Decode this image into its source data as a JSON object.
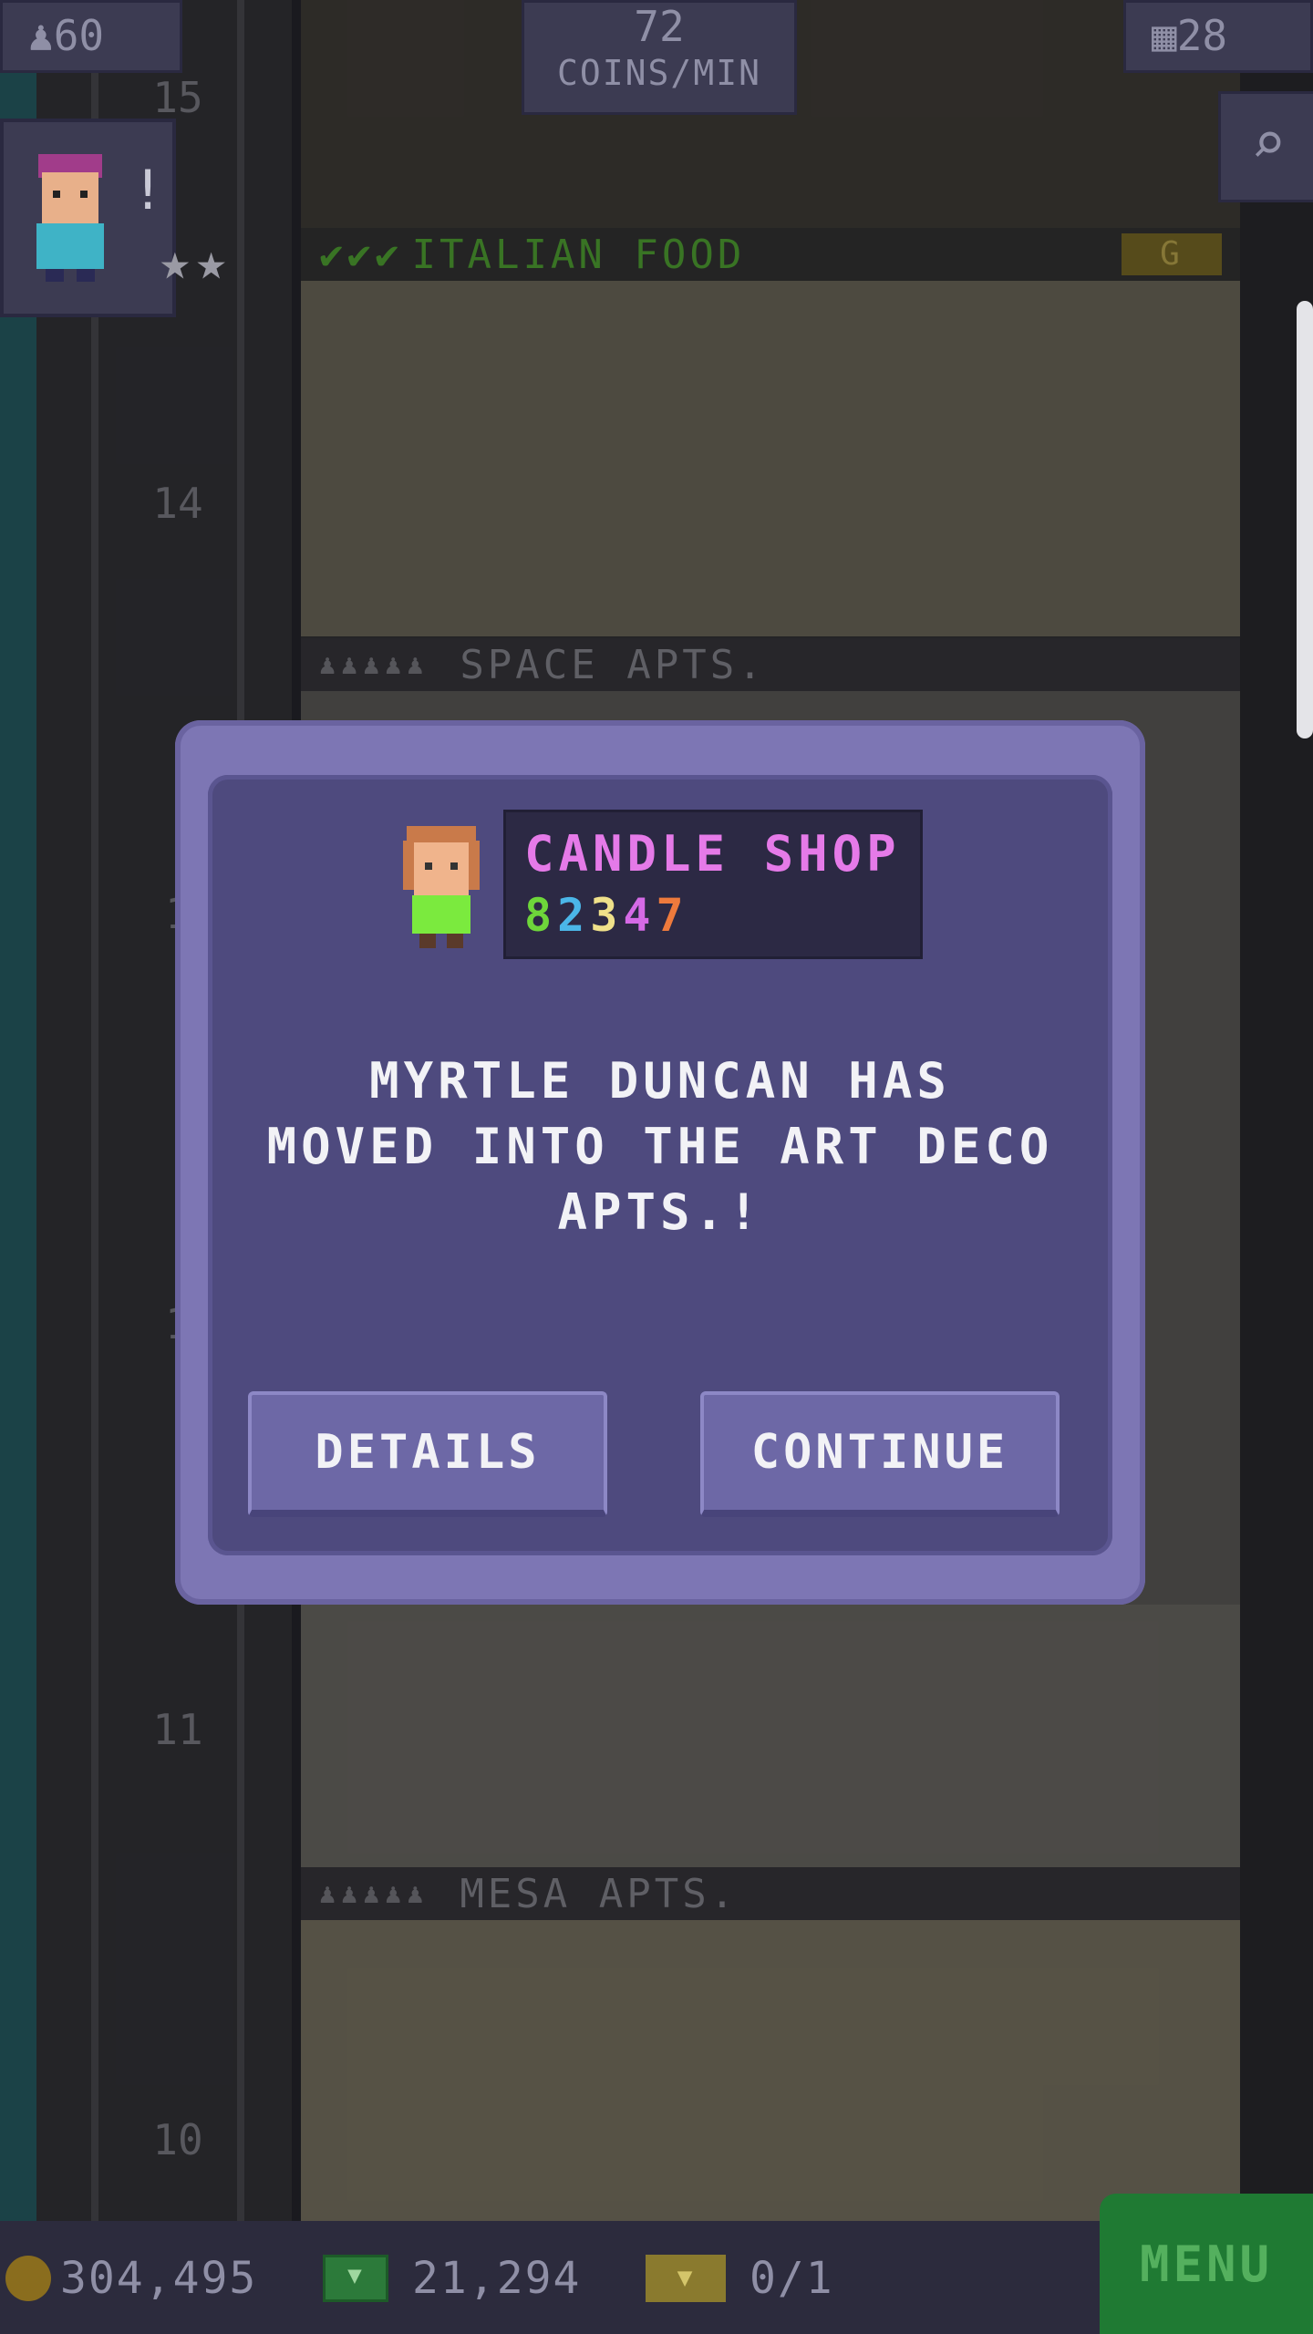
{
  "hud": {
    "population": "60",
    "coins_per_min_value": "72",
    "coins_per_min_label": "COINS/MIN",
    "floors": "28"
  },
  "tower": {
    "floor_numbers": [
      "15",
      "14",
      "1",
      "1",
      "11",
      "10"
    ],
    "italian_food_label": "ITALIAN FOOD",
    "italian_food_badge": "G",
    "space_apts_label": "SPACE APTS.",
    "mesa_apts_label": "MESA APTS."
  },
  "modal": {
    "shop_name": "CANDLE SHOP",
    "shop_code": [
      {
        "char": "8",
        "color": "#6ed63a"
      },
      {
        "char": "2",
        "color": "#4bb6e8"
      },
      {
        "char": "3",
        "color": "#efe08a"
      },
      {
        "char": "4",
        "color": "#d56ae6"
      },
      {
        "char": "7",
        "color": "#ee7a3c"
      }
    ],
    "message": "MYRTLE DUNCAN HAS\nMOVED INTO THE ART DECO\nAPTS.!",
    "details_label": "DETAILS",
    "continue_label": "CONTINUE"
  },
  "bottom": {
    "coins": "304,495",
    "bux": "21,294",
    "tickets": "0/1",
    "menu_label": "MENU"
  },
  "colors": {
    "modal_outer": "#7d76b4",
    "modal_inner": "#4e4a7e",
    "shop_name": "#e57ae8",
    "menu_green": "#1f7a33"
  }
}
